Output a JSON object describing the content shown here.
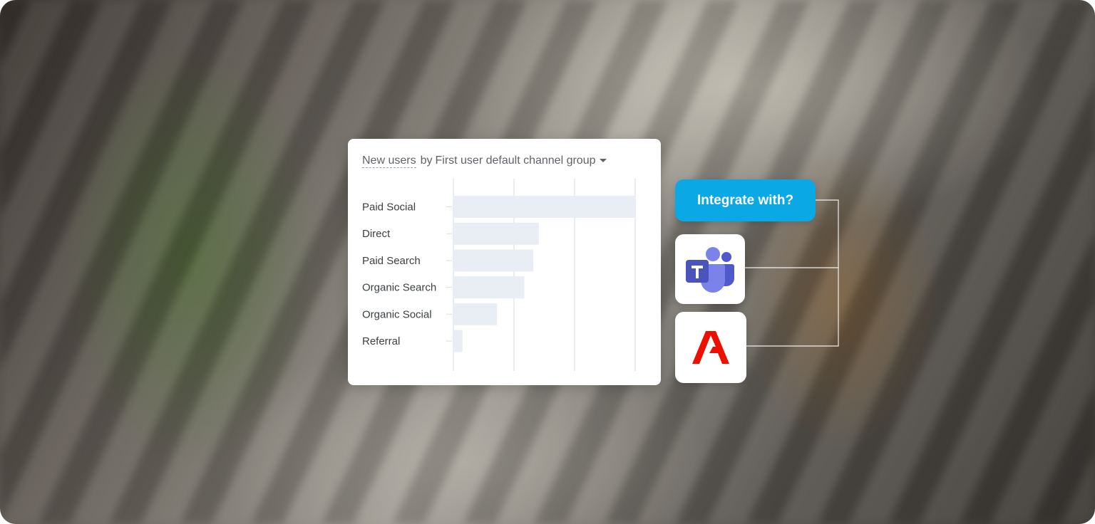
{
  "chart_data": {
    "type": "bar",
    "orientation": "horizontal",
    "title": "New users",
    "dimension": "First user default channel group",
    "categories": [
      "Paid Social",
      "Direct",
      "Paid Search",
      "Organic Search",
      "Organic Social",
      "Referral"
    ],
    "values": [
      100,
      47,
      44,
      39,
      24,
      5
    ],
    "xlim": [
      0,
      100
    ],
    "gridlines": 4,
    "bar_color": "#e8eef4"
  },
  "header": {
    "metric": "New users",
    "by": "by",
    "dimension": "First user default channel group"
  },
  "integrate": {
    "label": "Integrate with?"
  },
  "integrations": [
    {
      "name": "microsoft-teams-icon"
    },
    {
      "name": "adobe-icon"
    }
  ],
  "colors": {
    "accent": "#0aa8e5",
    "teams": "#5b5fc7",
    "adobe": "#eb1000"
  }
}
